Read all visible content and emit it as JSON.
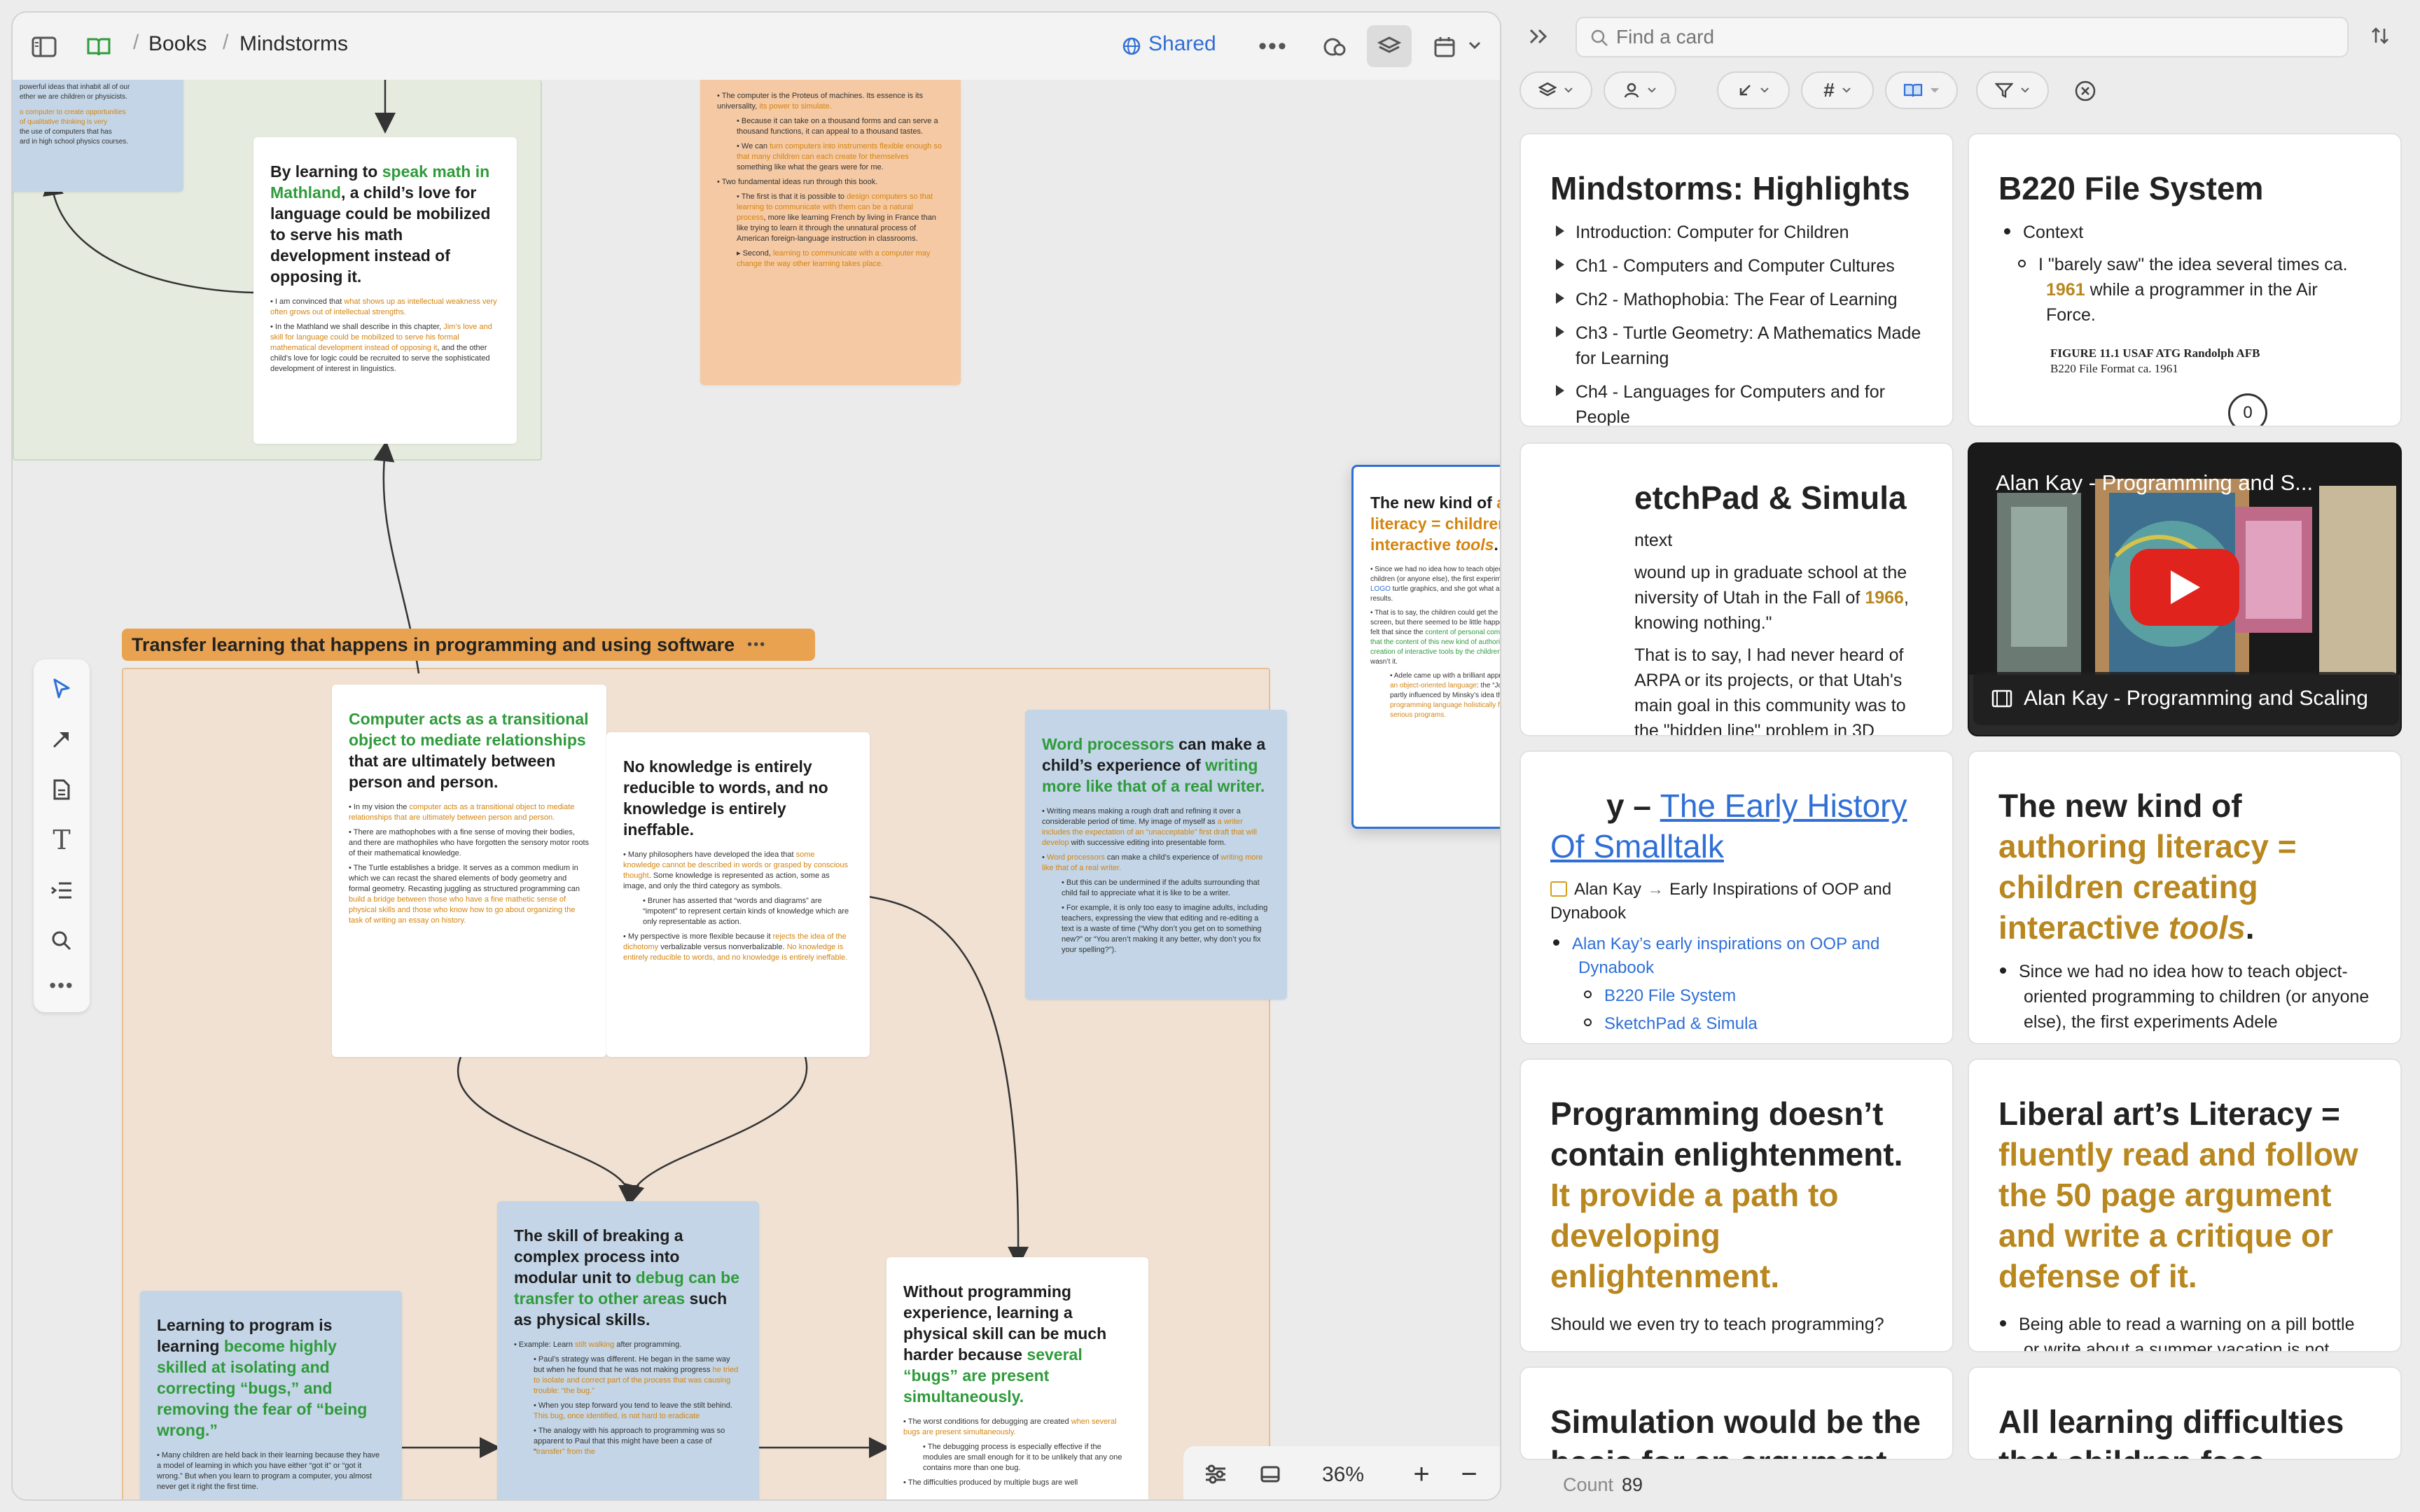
{
  "topbar": {
    "breadcrumb_books": "Books",
    "breadcrumb_current": "Mindstorms",
    "shared_label": "Shared"
  },
  "canvas": {
    "group_label": "Transfer learning that happens in programming and using software",
    "top_left_card": {
      "line1": "powerful ideas that inhabit all of our",
      "line2": "ether we are children or physicists.",
      "line3": "o computer to create opportunities",
      "line4": "of qualitative thinking is very",
      "line5": "the use of computers that has",
      "line6": "ard in high school physics courses."
    },
    "mathland_card": {
      "t1": "By learning to ",
      "t2": "speak math in Mathland",
      "t3": ", a child’s love for language could be mobilized to serve his math development instead of opposing it.",
      "p1a": "I am convinced that ",
      "p1b": "what shows up as intellectual weakness very often grows out of intellectual strengths.",
      "p2a": "In the Mathland we shall describe in this chapter, ",
      "p2b": "Jim’s love and skill for language could be mobilized to serve his formal mathematical development instead of opposing it",
      "p2c": ", and the other child’s love for logic could be recruited to serve the sophisticated development of interest in linguistics."
    },
    "proteus_card": {
      "p1a": "The computer is the Proteus of machines. Its essence is its universality, ",
      "p1b": "its power to simulate.",
      "p2": "Because it can take on a thousand forms and can serve a thousand functions, it can appeal to a thousand tastes.",
      "p3a": "We can ",
      "p3b": "turn computers into instruments flexible enough so that many children can each create for themselves",
      "p3c": " something like what the gears were for me.",
      "p4": "Two fundamental ideas run through this book.",
      "p5a": "The first is that it is possible to ",
      "p5b": "design computers so that learning to communicate with them can be a natural process",
      "p5c": ", more like learning French by living in France than like trying to learn it through the unnatural process of American foreign-language instruction in classrooms.",
      "p6a": "Second, ",
      "p6b": "learning to communicate with a computer may change the way other learning takes place."
    },
    "transitional_card": {
      "t1": "Computer acts as a transitional object to mediate relationships",
      "t2": " that are ultimately between person and person.",
      "p1a": "In my vision the ",
      "p1b": "computer acts as a transitional object to mediate relationships that are ultimately between person and person.",
      "p2": "There are mathophobes with a fine sense of moving their bodies, and there are mathophiles who have forgotten the sensory motor roots of their mathematical knowledge.",
      "p3a": "The Turtle establishes a bridge. It serves as a common medium in which we can recast the shared elements of body geometry and formal geometry. Recasting juggling as structured programming can ",
      "p3b": "build a bridge between those who have a fine mathetic sense of physical skills and those who know how to go about organizing the task of writing an essay on history."
    },
    "words_card": {
      "title": "No knowledge is entirely reducible to words, and no knowledge is entirely ineffable.",
      "p1a": "Many philosophers have developed the idea that ",
      "p1b": "some knowledge cannot be described in words or grasped by conscious thought",
      "p1c": ". Some knowledge is represented as action, some as image, and only the third category as symbols.",
      "p2": "Bruner has asserted that “words and diagrams” are “impotent” to represent certain kinds of knowledge which are only representable as action.",
      "p3a": "My perspective is more flexible because it ",
      "p3b": "rejects the idea of the dichotomy",
      "p3c": " verbalizable versus nonverbalizable. ",
      "p3d": "No knowledge is entirely reducible to words, and no knowledge is entirely ineffable."
    },
    "word_processor_card": {
      "t1": "Word processors",
      "t2": " can make a child’s experience of ",
      "t3": "writing more like that of a real writer.",
      "p1a": "Writing means making a rough draft and refining it over a considerable period of time. My image of myself as ",
      "p1b": "a writer includes the expectation of an “unacceptable” first draft that will develop",
      "p1c": " with successive editing into presentable form.",
      "p2a": "Word processors",
      "p2b": " can make a child’s experience of ",
      "p2c": "writing more like that of a real writer.",
      "p3": "But this can be undermined if the adults surrounding that child fail to appreciate what it is like to be a writer.",
      "p4": "For example, it is only too easy to imagine adults, including teachers, expressing the view that editing and re-editing a text is a waste of time (“Why don’t you get on to something new?” or “You aren’t making it any better, why don’t you fix your spelling?”)."
    },
    "authoring_card": {
      "t1": "The new kind of ",
      "t2": "authoring literacy = children creating interactive ",
      "t3": "tools",
      "t4": ".",
      "p1a": "Since we had no idea how to teach object-oriented programming to children (or anyone else), the first experiments Adele did mimicked ",
      "p1b": "LOGO",
      "p1c": " turtle graphics, and she got what appeared to be very similar results.",
      "p2a": "That is to say, the children could get the turtle to draw pictures on the screen, but there seemed to be little happening beyond surface effects. I felt that since the ",
      "p2b": "content of personal computing was interactive tools, that the content of this new kind of authoring literacy should be the creation of interactive tools by the children",
      "p2c": ". Procedural turtle graphics just wasn’t it.",
      "p3a": "Adele came up with a brilliant approach to ",
      "p3b": "teaching Smalltalk as an object-oriented language",
      "p3c": ": the “Joe Book.” I believe this was partly influenced by Minsky’s idea that you should ",
      "p3d": "teach a programming language holistically from working examples of serious programs."
    },
    "debugging_card": {
      "t1": "Learning to program is learning ",
      "t2": "become highly skilled at isolating and correcting “bugs,” and removing the fear of “being wrong.”",
      "p1": "Many children are held back in their learning because they have a model of learning in which you have either “got it” or “got it wrong.” But when you learn to program a computer, you almost never get it right the first time."
    },
    "modular_card": {
      "t1": "The skill of breaking a complex process into modular unit to ",
      "t2": "debug can be transfer to other areas",
      "t3": " such as physical skills.",
      "p1a": "Example: Learn ",
      "p1b": "stilt walking",
      "p1c": " after programming.",
      "p2a": "Paul’s strategy was different. He began in the same way but when he found that he was not making progress ",
      "p2b": "he tried to isolate and correct part of the process that was causing trouble: “the bug.”",
      "p3a": "When you step forward you tend to leave the stilt behind. ",
      "p3b": "This bug, once identified, is not hard to eradicate",
      "p4a": "The analogy with his approach to programming was so apparent to Paul that this might have been a case of “",
      "p4b": "transfer” from the"
    },
    "physical_card": {
      "t1": "Without programming experience, learning a physical skill can be much harder because ",
      "t2": "several “bugs” are present simultaneously.",
      "p1a": "The worst conditions for debugging are created ",
      "p1b": "when several bugs are present simultaneously.",
      "p2": "The debugging process is especially effective if the modules are small enough for it to be unlikely that any one contains more than one bug.",
      "p3": "The difficulties produced by multiple bugs are well"
    }
  },
  "zoom": {
    "level": "36%"
  },
  "search": {
    "placeholder": "Find a card"
  },
  "cards": {
    "highlights": {
      "title": "Mindstorms: Highlights",
      "items": [
        "Introduction: Computer for Children",
        "Ch1 - Computers and Computer Cultures",
        "Ch2 - Mathophobia: The Fear of Learning",
        "Ch3 - Turtle Geometry: A Mathematics Made for Learning",
        "Ch4 - Languages for Computers and for People"
      ]
    },
    "b220": {
      "title": "B220 File System",
      "item": "Context",
      "sub_a": "I \"barely saw\" the idea several times ca. ",
      "sub_year": "1961",
      "sub_b": " while a programmer in the Air Force.",
      "figure_caption": "FIGURE 11.1   USAF ATG Randolph AFB",
      "figure_caption2": "B220 File Format ca. 1961",
      "figure_digit": "0"
    },
    "sketchpad": {
      "title": "etchPad & Simula",
      "context": "ntext",
      "l1": "wound up in graduate school at the",
      "l2a": "niversity of Utah in the Fall of ",
      "l2year": "1966",
      "l2b": ",",
      "l3": "knowing nothing.\"",
      "l4": "That is to say, I had never heard of",
      "l5": "ARPA or its projects, or that Utah's",
      "l6": "main goal in this community was to",
      "l7": "the \"hidden line\" problem in 3D"
    },
    "video": {
      "title": "Alan Kay - Programming and S...",
      "caption": "Alan Kay - Programming and Scaling"
    },
    "early_history": {
      "title_pre": "y – ",
      "title_link": "The Early History Of Smalltalk",
      "path_a": "Alan Kay",
      "path_b": "Early Inspirations of OOP and Dynabook",
      "link1": "Alan Kay’s early inspirations on OOP and Dynabook",
      "link2": "B220 File System",
      "link3": "SketchPad & Simula"
    },
    "authoring": {
      "t1": "The new kind of ",
      "t2": "authoring literacy = children creating interactive ",
      "t3": "tools",
      "t4": ".",
      "item": "Since we had no idea how to teach object-oriented programming to children (or anyone else), the first experiments Adele"
    },
    "enlightenment": {
      "t1": "Programming doesn’t contain enlightenment. ",
      "t2": "It provide a path to developing enlightenment.",
      "body": "Should we even try to teach programming?"
    },
    "liberal": {
      "t1": "Liberal art’s Literacy = ",
      "t2": "fluently read and follow the 50 page argument and write a critique or defense of it.",
      "item": "Being able to read a warning on a pill bottle or write about a summer vacation is not"
    },
    "simulation": {
      "t1": "Simulation would be the",
      "t2": "basis for an argument that"
    },
    "difficulties": {
      "t1": "All learning difficulties",
      "t2": "that children face"
    }
  },
  "footer": {
    "count_label": "Count",
    "count_value": "89"
  },
  "colors": {
    "accent_blue": "#2f6fd6",
    "accent_green": "#2f9b3b",
    "accent_orange": "#d4840f",
    "gold": "#b8871f",
    "group_orange": "#e9a250"
  }
}
